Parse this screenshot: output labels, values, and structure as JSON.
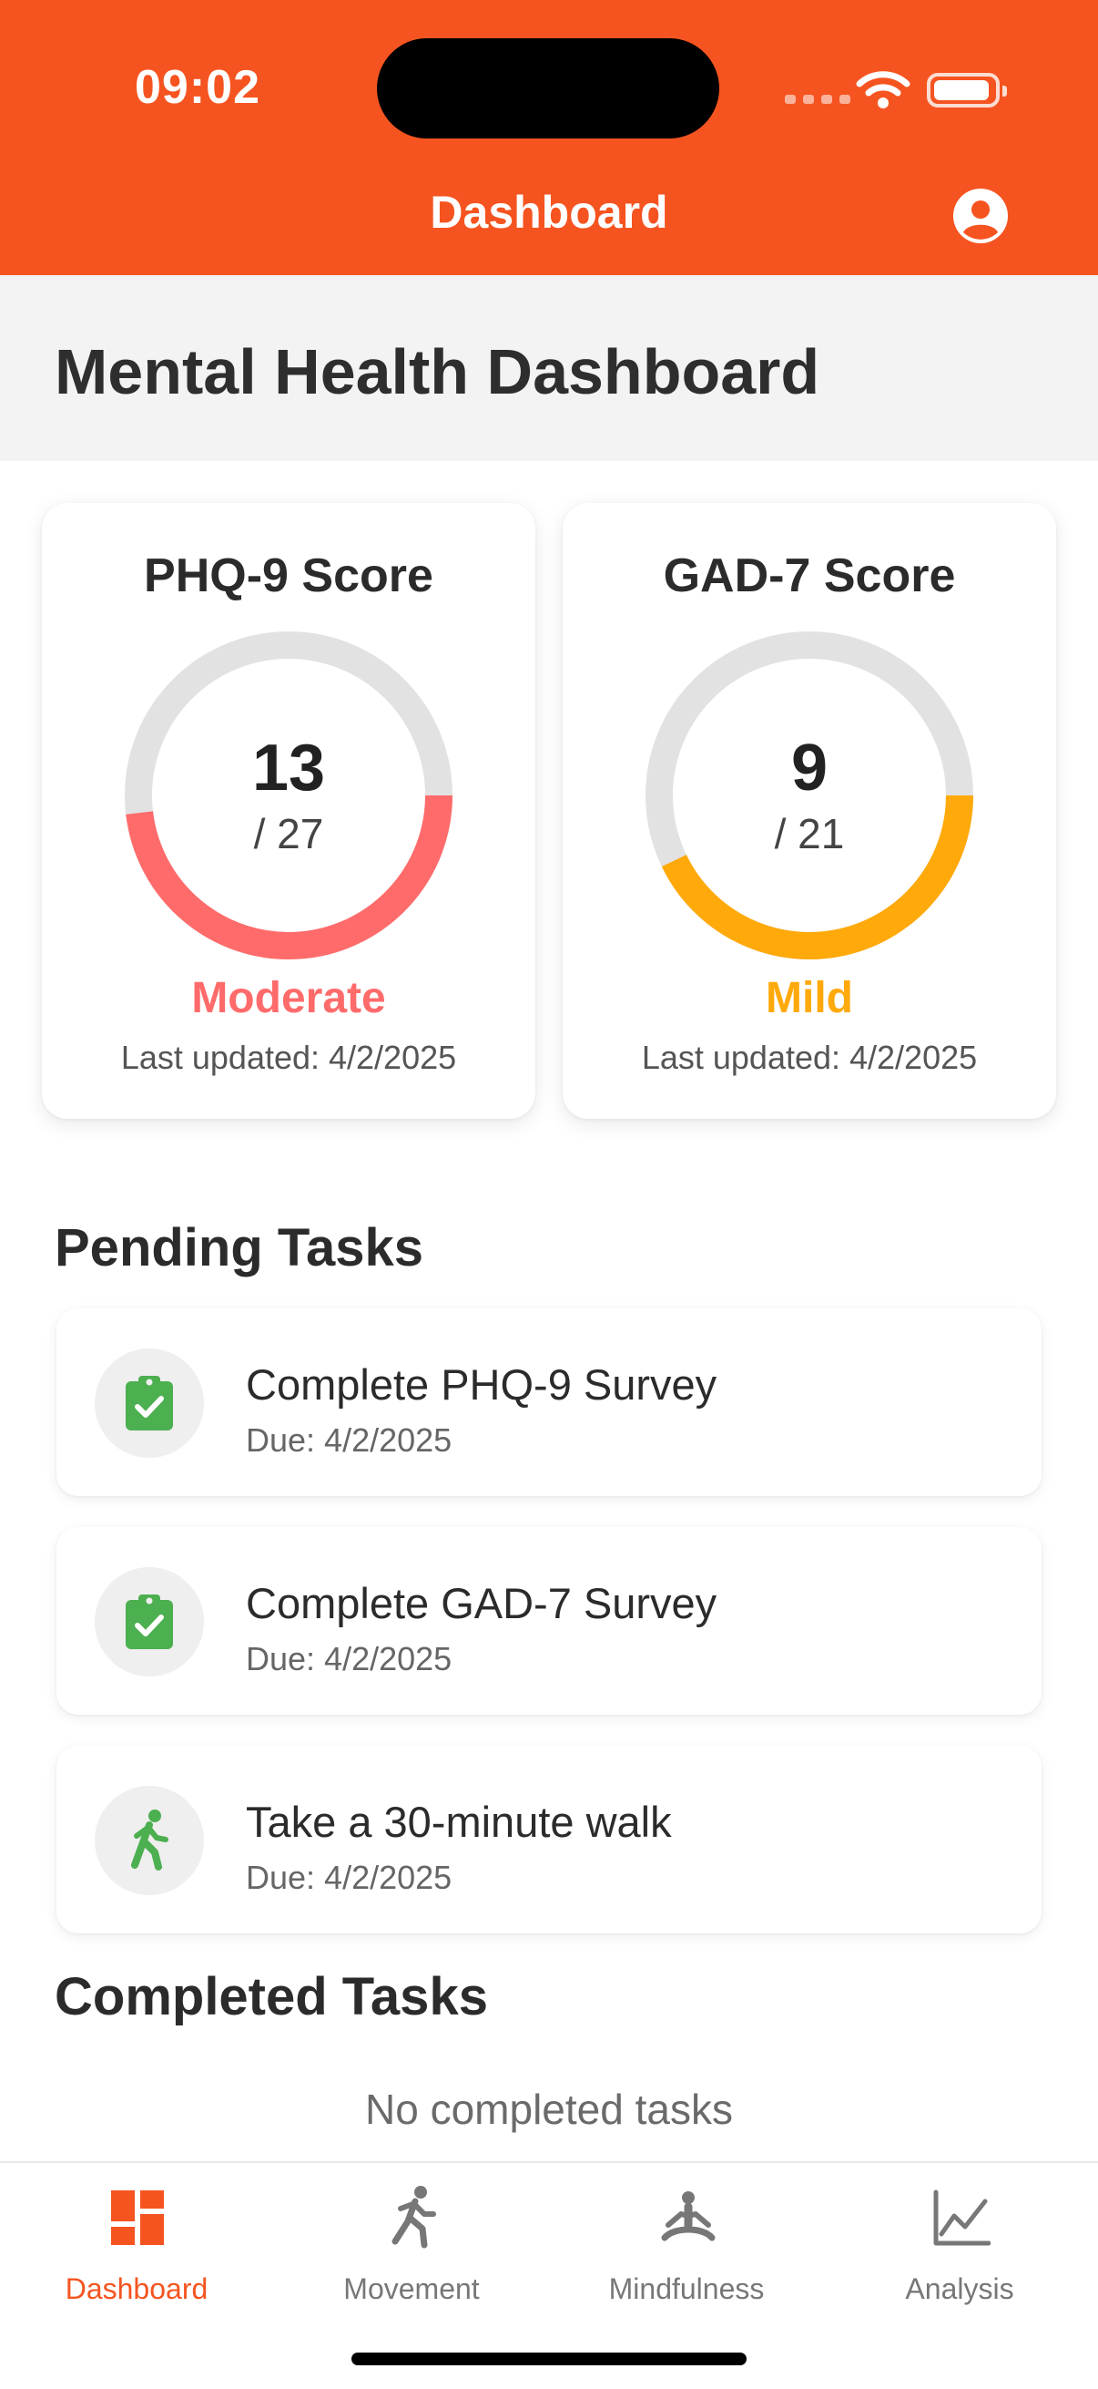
{
  "status_bar": {
    "time": "09:02"
  },
  "nav": {
    "title": "Dashboard"
  },
  "page": {
    "title": "Mental Health Dashboard"
  },
  "scores": [
    {
      "title": "PHQ-9 Score",
      "value": "13",
      "max_label": "/ 27",
      "value_num": 13,
      "max_num": 27,
      "severity": "Moderate",
      "color": "#FF6B6B",
      "updated": "Last updated: 4/2/2025"
    },
    {
      "title": "GAD-7 Score",
      "value": "9",
      "max_label": "/ 21",
      "value_num": 9,
      "max_num": 21,
      "severity": "Mild",
      "color": "#FFA90A",
      "updated": "Last updated: 4/2/2025"
    }
  ],
  "pending": {
    "title": "Pending Tasks",
    "tasks": [
      {
        "title": "Complete PHQ-9 Survey",
        "due": "Due: 4/2/2025",
        "icon": "clipboard-check-icon"
      },
      {
        "title": "Complete GAD-7 Survey",
        "due": "Due: 4/2/2025",
        "icon": "clipboard-check-icon"
      },
      {
        "title": "Take a 30-minute walk",
        "due": "Due: 4/2/2025",
        "icon": "walking-icon"
      }
    ]
  },
  "completed": {
    "title": "Completed Tasks",
    "empty": "No completed tasks"
  },
  "tabs": [
    {
      "label": "Dashboard",
      "icon": "dashboard-icon",
      "active": true
    },
    {
      "label": "Movement",
      "icon": "running-icon",
      "active": false
    },
    {
      "label": "Mindfulness",
      "icon": "meditation-icon",
      "active": false
    },
    {
      "label": "Analysis",
      "icon": "line-chart-icon",
      "active": false
    }
  ],
  "colors": {
    "primary": "#F55420",
    "task_icon": "#4CAF50",
    "gauge_track": "#E2E2E2"
  }
}
